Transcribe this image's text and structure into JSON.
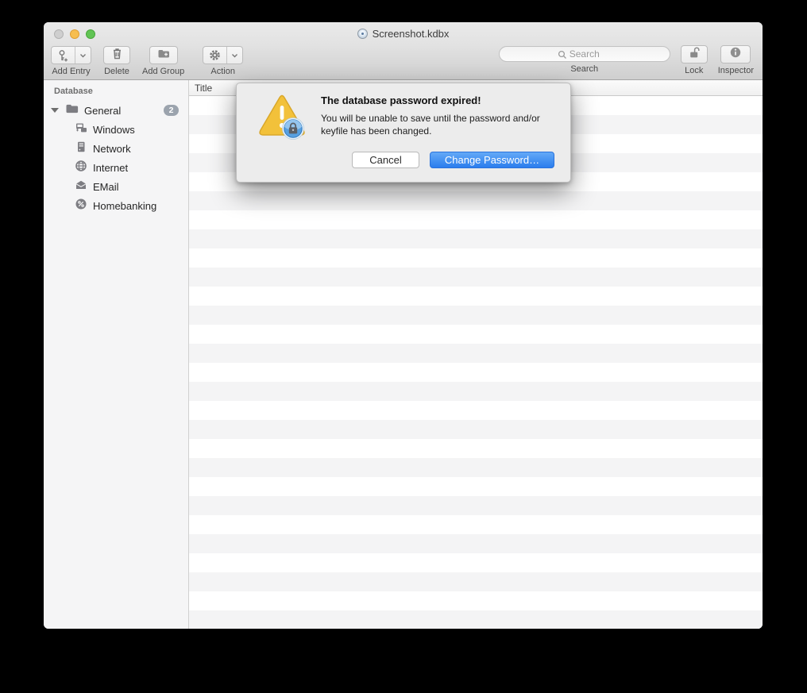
{
  "window": {
    "title": "Screenshot.kdbx"
  },
  "toolbar": {
    "add_entry_label": "Add Entry",
    "delete_label": "Delete",
    "add_group_label": "Add Group",
    "action_label": "Action",
    "search_placeholder": "Search",
    "search_label": "Search",
    "lock_label": "Lock",
    "inspector_label": "Inspector"
  },
  "sidebar": {
    "header": "Database",
    "group": {
      "label": "General",
      "badge": "2"
    },
    "items": [
      {
        "label": "Windows",
        "icon": "windows-network-icon"
      },
      {
        "label": "Network",
        "icon": "server-icon"
      },
      {
        "label": "Internet",
        "icon": "globe-icon"
      },
      {
        "label": "EMail",
        "icon": "envelope-icon"
      },
      {
        "label": "Homebanking",
        "icon": "percent-icon"
      }
    ]
  },
  "table": {
    "title_column": "Title"
  },
  "dialog": {
    "title": "The database password expired!",
    "body": "You will be unable to save until the password and/or keyfile has been changed.",
    "cancel_label": "Cancel",
    "confirm_label": "Change Password…"
  },
  "colors": {
    "confirm_blue": "#2b7ded",
    "warning_yellow": "#f2c13a",
    "badge_gray": "#9ba3ad"
  }
}
